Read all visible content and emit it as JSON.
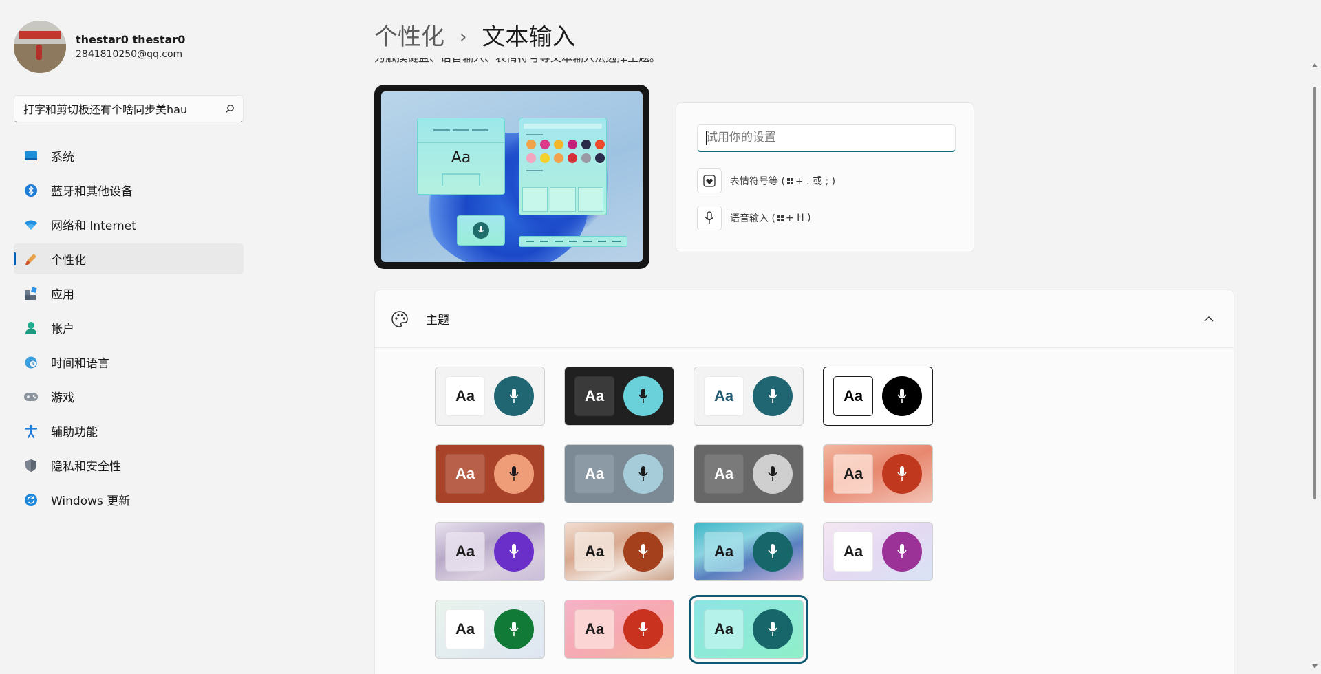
{
  "user": {
    "name": "thestar0 thestar0",
    "email": "2841810250@qq.com"
  },
  "search": {
    "value": "打字和剪切板还有个啥同步美hau"
  },
  "nav": {
    "items": [
      {
        "label": "系统",
        "icon": "monitor-icon"
      },
      {
        "label": "蓝牙和其他设备",
        "icon": "bluetooth-icon"
      },
      {
        "label": "网络和 Internet",
        "icon": "wifi-icon"
      },
      {
        "label": "个性化",
        "icon": "brush-icon",
        "active": true
      },
      {
        "label": "应用",
        "icon": "apps-icon"
      },
      {
        "label": "帐户",
        "icon": "account-icon"
      },
      {
        "label": "时间和语言",
        "icon": "globe-clock-icon"
      },
      {
        "label": "游戏",
        "icon": "gamepad-icon"
      },
      {
        "label": "辅助功能",
        "icon": "accessibility-icon"
      },
      {
        "label": "隐私和安全性",
        "icon": "shield-icon"
      },
      {
        "label": "Windows 更新",
        "icon": "update-icon"
      }
    ]
  },
  "header": {
    "parent": "个性化",
    "separator": "›",
    "title": "文本输入"
  },
  "intro_cut": "为触摸键盘、语音输入、表情符号等文本输入法选择主题。",
  "preview": {
    "sample": "Aa"
  },
  "try": {
    "placeholder": "试用你的设置",
    "emoji_label": "表情符号等 (",
    "emoji_keys": " + . 或 ; )",
    "voice_label": "语音输入 (",
    "voice_keys": " + H )"
  },
  "theme_section": {
    "title": "主题",
    "expanded": true
  },
  "theme_tiles": [
    {
      "aa": "Aa",
      "bg": "#f3f3f3",
      "aa_bg": "#ffffff",
      "aa_fg": "#1b1b1b",
      "mic_bg": "#1f6672",
      "mic_fg": "#ffffff"
    },
    {
      "aa": "Aa",
      "bg": "#202020",
      "aa_bg": "#3a3a3a",
      "aa_fg": "#ffffff",
      "mic_bg": "#6ad1da",
      "mic_fg": "#1b1b1b"
    },
    {
      "aa": "Aa",
      "bg": "#f3f3f3",
      "aa_bg": "#ffffff",
      "aa_fg": "#1f5a72",
      "mic_bg": "#1f6672",
      "mic_fg": "#ffffff"
    },
    {
      "aa": "Aa",
      "bg": "#ffffff",
      "aa_bg": "#ffffff",
      "aa_fg": "#000000",
      "mic_bg": "#000000",
      "mic_fg": "#ffffff"
    },
    {
      "aa": "Aa",
      "bg": "#a8432a",
      "aa_bg": "#b8604a",
      "aa_fg": "#ffffff",
      "mic_bg": "#ef9c78",
      "mic_fg": "#1b1b1b"
    },
    {
      "aa": "Aa",
      "bg": "#7b8a95",
      "aa_bg": "#8b9aa5",
      "aa_fg": "#ffffff",
      "mic_bg": "#a5ccd8",
      "mic_fg": "#1b1b1b"
    },
    {
      "aa": "Aa",
      "bg": "#676767",
      "aa_bg": "#7a7a7a",
      "aa_fg": "#ffffff",
      "mic_bg": "#cfcfcf",
      "mic_fg": "#1b1b1b"
    },
    {
      "aa": "Aa",
      "bg": "linear-gradient(160deg,#f2b7a0,#e8876f 45%,#f2c3b5)",
      "aa_bg": "rgba(255,235,225,0.7)",
      "aa_fg": "#1b1b1b",
      "mic_bg": "#c0391f",
      "mic_fg": "#ffffff"
    },
    {
      "aa": "Aa",
      "bg": "linear-gradient(160deg,#e9e3ef,#b8a9c9 40%,#d9cfdf 70%,#c8bcd8)",
      "aa_bg": "rgba(235,228,240,0.8)",
      "aa_fg": "#1b1b1b",
      "mic_bg": "#6b2fc9",
      "mic_fg": "#ffffff"
    },
    {
      "aa": "Aa",
      "bg": "linear-gradient(160deg,#f2ded2,#d9a98f 40%,#f0e4dc 70%,#caa28a)",
      "aa_bg": "rgba(245,232,224,0.8)",
      "aa_fg": "#1b1b1b",
      "mic_bg": "#a4401b",
      "mic_fg": "#ffffff"
    },
    {
      "aa": "Aa",
      "bg": "linear-gradient(160deg,#3fb7c8,#8ad4e0 35%,#5a7fbf 60%,#c6b0d9)",
      "aa_bg": "rgba(170,225,235,0.75)",
      "aa_fg": "#1b1b1b",
      "mic_bg": "#17676a",
      "mic_fg": "#ffffff"
    },
    {
      "aa": "Aa",
      "bg": "linear-gradient(150deg,#f5e8f2,#e4d9f2 50%,#d9e4f5)",
      "aa_bg": "#ffffff",
      "aa_fg": "#1b1b1b",
      "mic_bg": "#9a3297",
      "mic_fg": "#ffffff"
    },
    {
      "aa": "Aa",
      "bg": "linear-gradient(150deg,#e8f3ec,#dfe6f2)",
      "aa_bg": "#ffffff",
      "aa_fg": "#1b1b1b",
      "mic_bg": "#117a37",
      "mic_fg": "#ffffff"
    },
    {
      "aa": "Aa",
      "bg": "linear-gradient(150deg,#f4b4c8,#f6a9b2 50%,#f7b89e)",
      "aa_bg": "#fbd5d3",
      "aa_fg": "#1b1b1b",
      "mic_bg": "#c8321f",
      "mic_fg": "#ffffff"
    },
    {
      "aa": "Aa",
      "bg": "linear-gradient(150deg,#8fe3e6,#8ef0c8)",
      "aa_bg": "#b5f3ea",
      "aa_fg": "#1b1b1b",
      "mic_bg": "#17676a",
      "mic_fg": "#ffffff",
      "selected": true
    }
  ],
  "colors": {
    "accent": "#005fb8",
    "input_focus": "#0f6a76",
    "selected_outline": "#0f5a72"
  }
}
